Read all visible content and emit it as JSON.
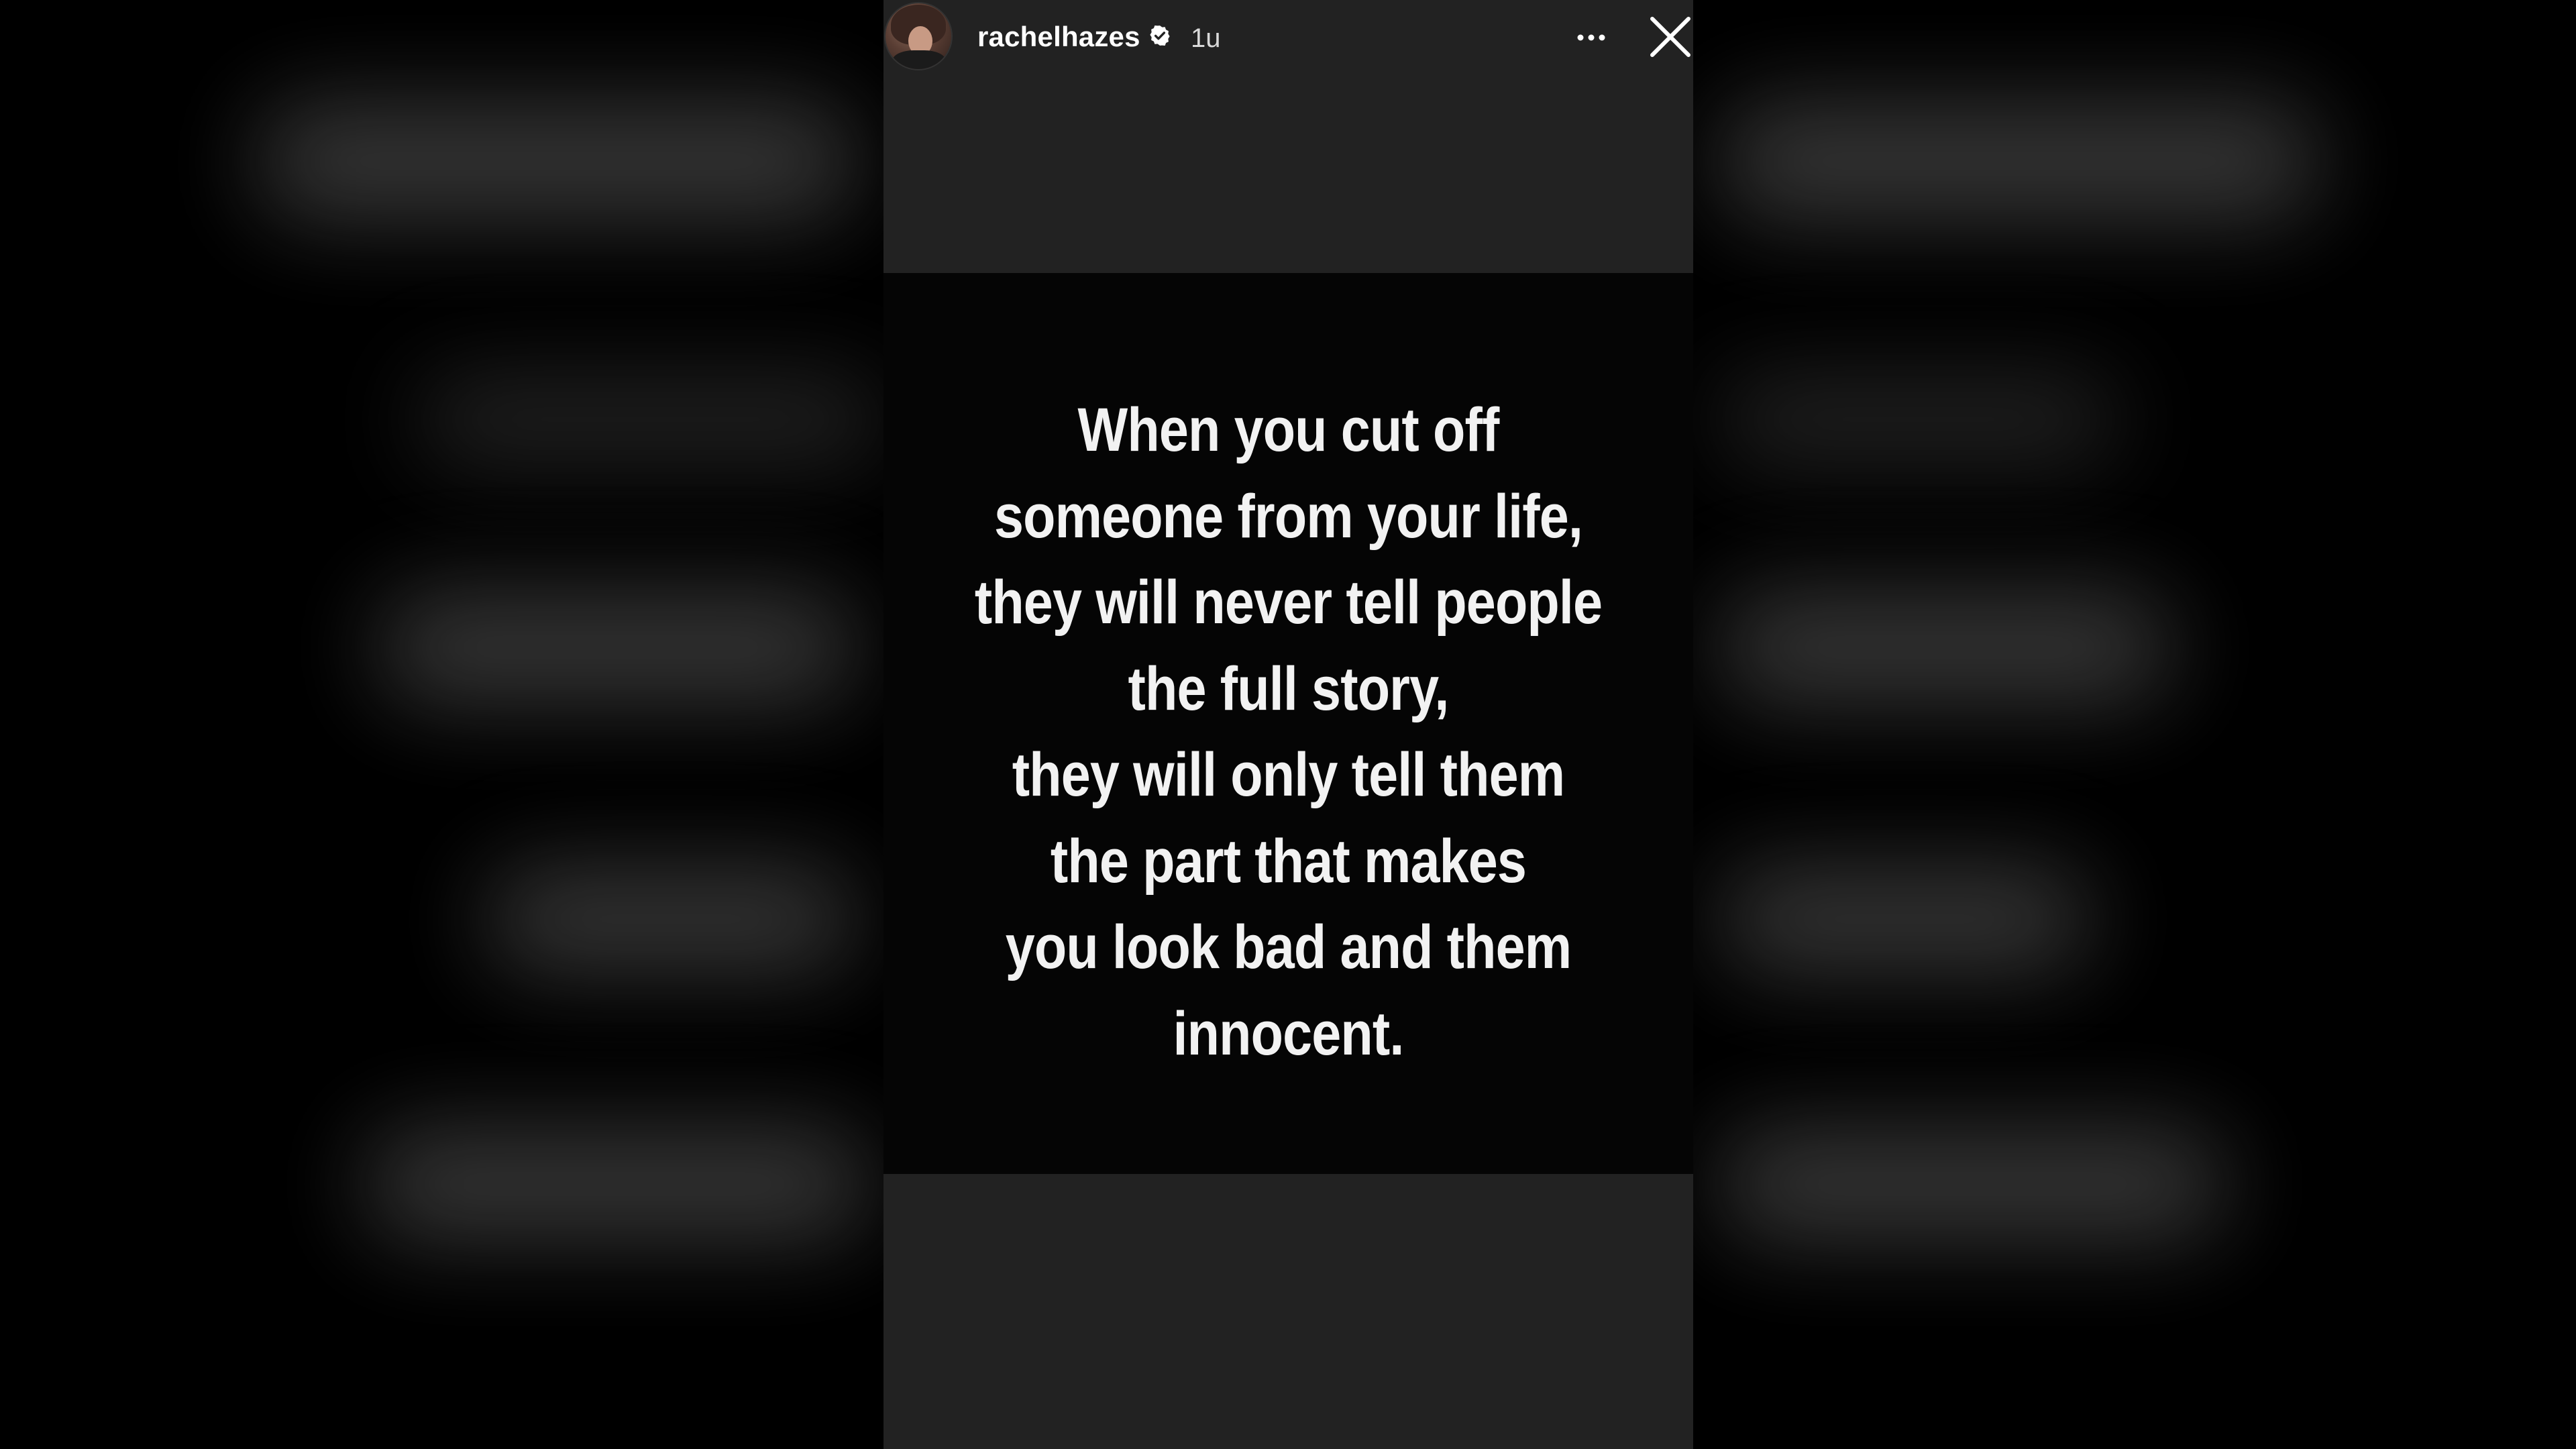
{
  "story": {
    "username": "rachelhazes",
    "verified": true,
    "time_ago": "1u",
    "quote_lines": [
      "When you cut off",
      "someone from your life,",
      "they will never tell people",
      "the full story,",
      "they will only tell them",
      "the part that makes",
      "you look bad and them",
      "innocent."
    ]
  },
  "icons": {
    "verified": "verified-badge-icon",
    "more": "more-options-icon",
    "close": "close-icon"
  },
  "colors": {
    "page_background": "#000000",
    "story_background": "#222222",
    "quote_card_background": "#050505",
    "text": "#ffffff"
  }
}
